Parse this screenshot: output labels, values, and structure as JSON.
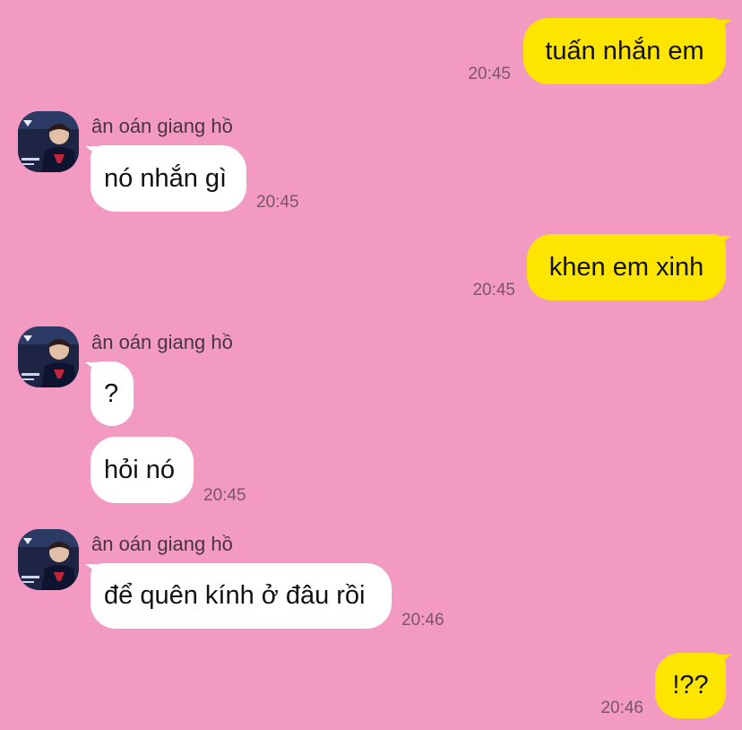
{
  "chat": {
    "sender_name": "ân oán giang hồ",
    "messages": [
      {
        "id": "m1",
        "direction": "outgoing",
        "text": "tuấn nhắn em",
        "time": "20:45"
      },
      {
        "id": "m2",
        "direction": "incoming",
        "text": "nó nhắn gì",
        "time": "20:45"
      },
      {
        "id": "m3",
        "direction": "outgoing",
        "text": "khen em xinh",
        "time": "20:45"
      },
      {
        "id": "m4",
        "direction": "incoming",
        "text": "?",
        "time": ""
      },
      {
        "id": "m5",
        "direction": "incoming",
        "text": "hỏi nó",
        "time": "20:45"
      },
      {
        "id": "m6",
        "direction": "incoming",
        "text": "để quên kính ở đâu rồi",
        "time": "20:46"
      },
      {
        "id": "m7",
        "direction": "outgoing",
        "text": "!??",
        "time": "20:46"
      }
    ]
  },
  "colors": {
    "background": "#f39ac3",
    "outgoing_bubble": "#fee500",
    "incoming_bubble": "#ffffff",
    "timestamp": "#7a5566"
  },
  "icons": {
    "avatar": "profile-photo-avatar"
  }
}
